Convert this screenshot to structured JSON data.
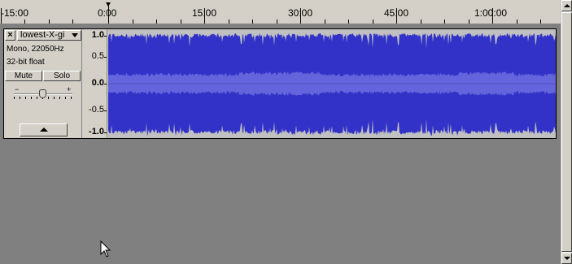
{
  "ruler": {
    "labels": [
      "-15:00",
      "0:00",
      "15:00",
      "30:00",
      "45:00",
      "1:00:00"
    ]
  },
  "track": {
    "close_glyph": "×",
    "name": "lowest-X-gi",
    "rate_info": "Mono, 22050Hz",
    "format_info": "32-bit float",
    "mute_label": "Mute",
    "solo_label": "Solo",
    "gain_minus": "−",
    "gain_plus": "+",
    "amplitude_labels": [
      "1.0",
      "0.5",
      "0.0",
      "-0.5",
      "-1.0"
    ]
  },
  "icons": {
    "close": "close-icon",
    "dropdown": "chevron-down-icon",
    "collapse": "collapse-up-icon",
    "cursor": "mouse-pointer-icon"
  },
  "colors": {
    "waveform": "#3232c8",
    "waveform_rms": "#6464dc",
    "waveform_bg": "#c0c0c0",
    "chrome": "#d4d0c8",
    "workspace": "#808080"
  }
}
